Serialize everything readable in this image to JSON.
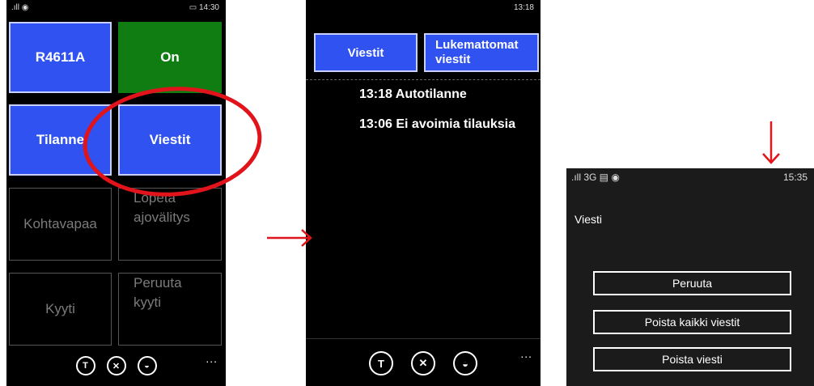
{
  "screen1": {
    "status": {
      "signal": ".ıll ◉",
      "time": "▭ 14:30"
    },
    "tiles": {
      "vehicle": "R4611A",
      "status_on": "On",
      "situation": "Tilanne",
      "messages": "Viestit",
      "free_spot": "Kohtavapaa",
      "stop_line1": "Lopeta",
      "stop_line2": "ajovälitys",
      "ride": "Kyyti",
      "cancel_line1": "Peruuta",
      "cancel_line2": "kyyti"
    },
    "appbar": {
      "more": "..."
    }
  },
  "screen2": {
    "status": {
      "time": "13:18"
    },
    "tabs": {
      "messages": "Viestit",
      "unread_line1": "Lukemattomat",
      "unread_line2": "viestit"
    },
    "messages": [
      {
        "text": "13:18 Autotilanne"
      },
      {
        "text": "13:06 Ei avoimia tilauksia"
      }
    ],
    "appbar": {
      "more": "..."
    }
  },
  "screen3": {
    "status": {
      "signal": ".ıll 3G ▤ ◉",
      "time": "15:35"
    },
    "title": "Viesti",
    "buttons": {
      "cancel": "Peruuta",
      "delete_all": "Poista kaikki viestit",
      "delete": "Poista viesti"
    }
  },
  "colors": {
    "tile_blue": "#2f52f0",
    "tile_green": "#0f7d12",
    "annotation_red": "#e0141a"
  }
}
